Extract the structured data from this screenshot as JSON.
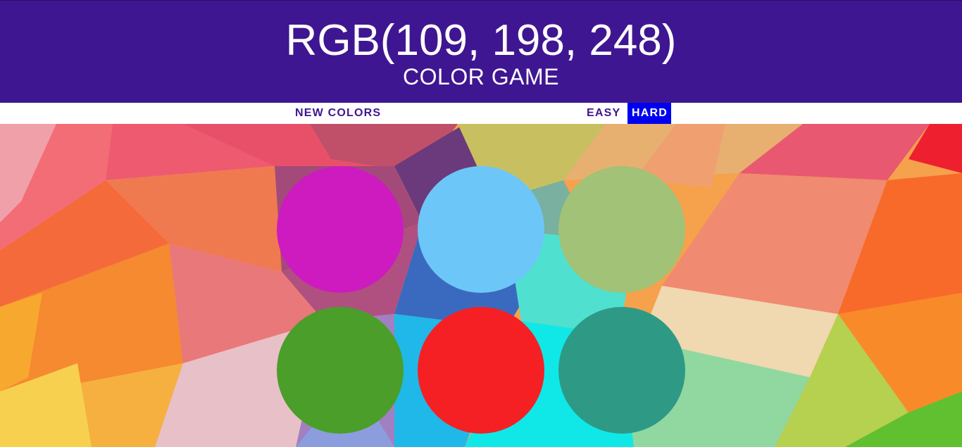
{
  "header": {
    "rgb_display": "RGB(109, 198, 248)",
    "subtitle": "COLOR GAME",
    "background": "#3f1691"
  },
  "stripe": {
    "new_colors_label": "NEW COLORS",
    "easy_label": "EASY",
    "hard_label": "HARD",
    "selected_mode": "hard",
    "accent": "#3f1691",
    "selected_color": "#0000f0"
  },
  "squares": [
    {
      "color": "#cd1bc0"
    },
    {
      "color": "#6dc6f8"
    },
    {
      "color": "#a1c277"
    },
    {
      "color": "#4a9e29"
    },
    {
      "color": "#f42024"
    },
    {
      "color": "#2e9a86"
    }
  ]
}
